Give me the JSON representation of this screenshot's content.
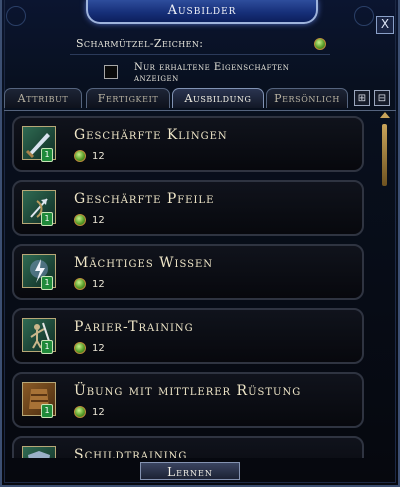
{
  "window": {
    "title": "Ausbilder",
    "close_label": "X"
  },
  "currency": {
    "label": "Scharmützel-Zeichen:",
    "icon": "skirmish-mark-icon"
  },
  "filter": {
    "label": "Nur erhaltene Eigenschaften anzeigen",
    "checked": false
  },
  "tabs": [
    {
      "label": "Attribut",
      "active": false
    },
    {
      "label": "Fertigkeit",
      "active": false
    },
    {
      "label": "Ausbildung",
      "active": true
    },
    {
      "label": "Persönlich",
      "active": false
    }
  ],
  "tab_icons": [
    "expand-icon",
    "collapse-icon"
  ],
  "items": [
    {
      "name": "Geschärfte Klingen",
      "cost": "12",
      "rank": "1",
      "icon": "sword-icon"
    },
    {
      "name": "Geschärfte Pfeile",
      "cost": "12",
      "rank": "1",
      "icon": "arrow-icon"
    },
    {
      "name": "Mächtiges Wissen",
      "cost": "12",
      "rank": "1",
      "icon": "lightning-icon"
    },
    {
      "name": "Parier-Training",
      "cost": "12",
      "rank": "1",
      "icon": "parry-icon"
    },
    {
      "name": "Übung mit mittlerer Rüstung",
      "cost": "12",
      "rank": "1",
      "icon": "armour-icon"
    },
    {
      "name": "Schildtraining",
      "cost": "",
      "rank": "",
      "icon": "shield-icon"
    }
  ],
  "learn_button": "Lernen",
  "colors": {
    "title_bar": "#17307a",
    "token_green": "#5aa02a",
    "rank_badge": "#1f8a3a",
    "text_gold": "#efe6c8"
  }
}
